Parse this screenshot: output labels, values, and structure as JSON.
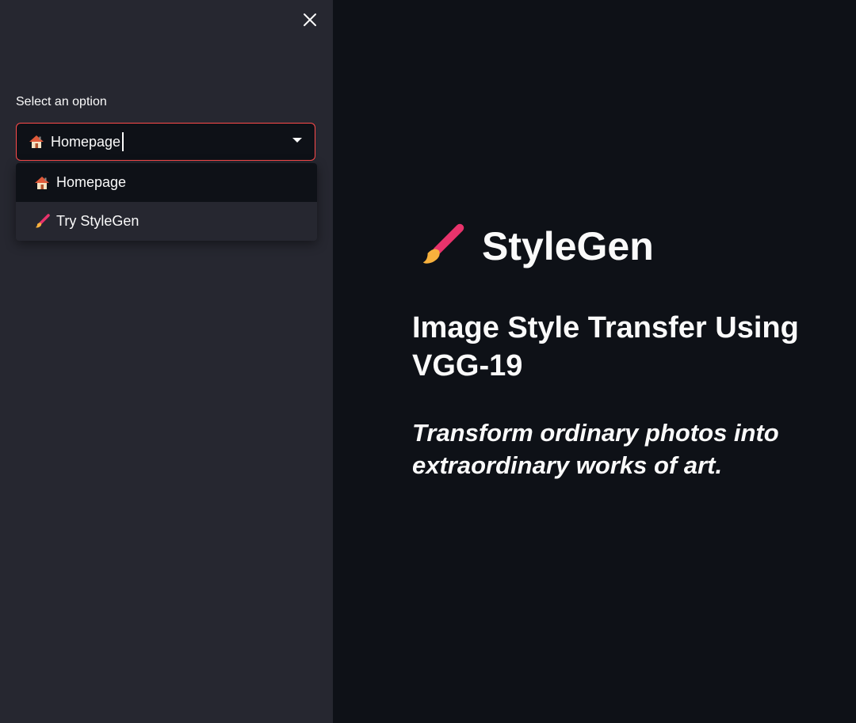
{
  "sidebar": {
    "close_icon": "close-icon",
    "select": {
      "label": "Select an option",
      "value": "Homepage",
      "value_icon": "house-icon",
      "options": [
        {
          "label": "Homepage",
          "icon": "house-icon",
          "active": true
        },
        {
          "label": "Try StyleGen",
          "icon": "paintbrush-icon",
          "active": false
        }
      ]
    }
  },
  "main": {
    "title": "StyleGen",
    "title_icon": "paintbrush-icon",
    "subheading": "Image Style Transfer Using VGG-19",
    "tagline": "Transform ordinary photos into extraordinary works of art."
  },
  "colors": {
    "sidebar_bg": "#262730",
    "main_bg": "#0e1117",
    "accent": "#ff4b4b",
    "text": "#fafafa"
  }
}
